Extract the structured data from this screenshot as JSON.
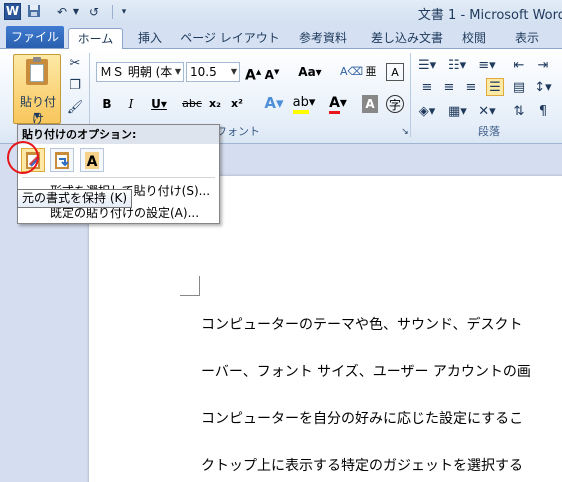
{
  "window_title": "文書 1 - Microsoft Word",
  "qat": {
    "word_icon": "W",
    "save_icon": "save-icon",
    "undo_glyph": "↶",
    "redo_glyph": "↺"
  },
  "tabs": [
    {
      "label": "ファイル"
    },
    {
      "label": "ホーム"
    },
    {
      "label": "挿入"
    },
    {
      "label": "ページ レイアウト"
    },
    {
      "label": "参考資料"
    },
    {
      "label": "差し込み文書"
    },
    {
      "label": "校閲"
    },
    {
      "label": "表示"
    }
  ],
  "ribbon": {
    "paste_label": "貼り付け",
    "font_name": "ＭＳ 明朝 (本",
    "font_size": "10.5",
    "font_group_label": "フォント",
    "paragraph_group_label": "段落"
  },
  "paste_options": {
    "title": "貼り付けのオプション:",
    "special": "形式を選択して貼り付け(S)...",
    "default": "既定の貼り付けの設定(A)..."
  },
  "tooltip": "元の書式を保持 (K)",
  "document": {
    "lines": [
      "コンピューターのテーマや色、サウンド、デスクト",
      "ーバー、フォント サイズ、ユーザー アカウントの画",
      "コンピューターを自分の好みに応じた設定にするこ",
      "クトップ上に表示する特定のガジェットを選択する"
    ]
  },
  "colors": {
    "accent": "#2b579a",
    "highlight": "#fde9a6",
    "callout": "#e8161b"
  }
}
